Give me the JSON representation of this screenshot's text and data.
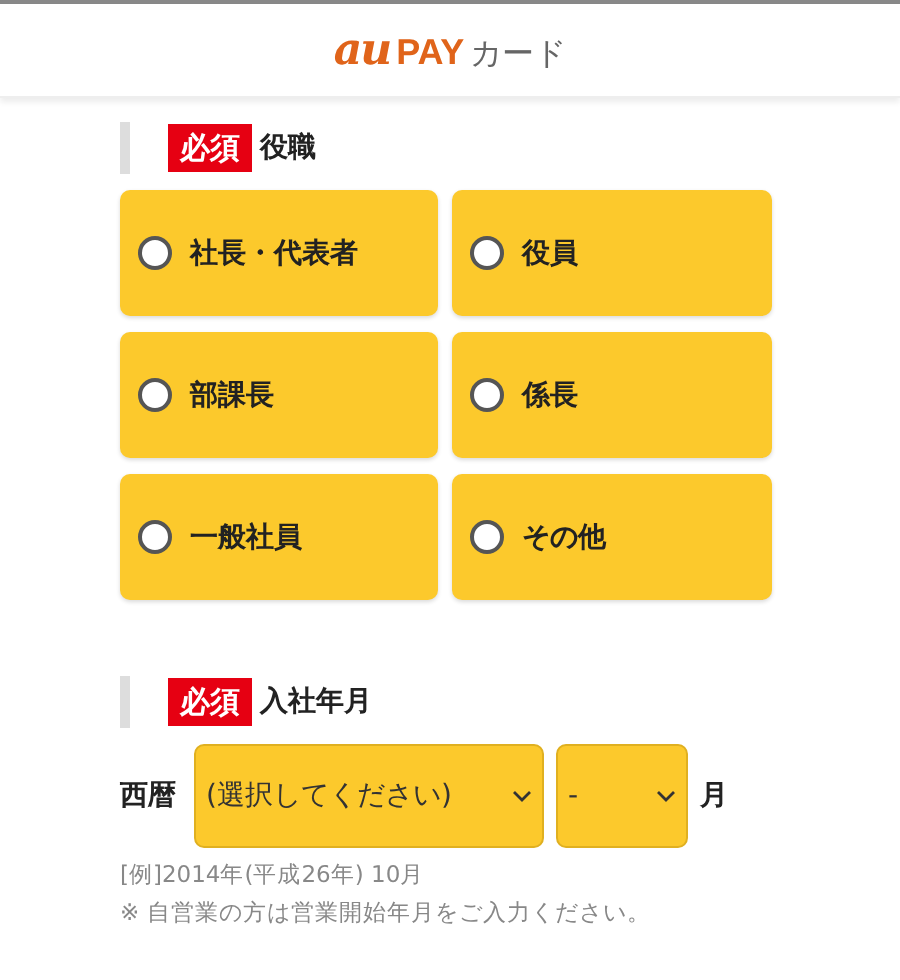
{
  "header": {
    "logo": {
      "brand": "au",
      "pay": "PAY",
      "suffix": "カード"
    }
  },
  "sections": [
    {
      "badge": "必須",
      "label": "役職",
      "kind": "radios",
      "options": [
        {
          "label": "社長・代表者",
          "selected": false
        },
        {
          "label": "役員",
          "selected": false
        },
        {
          "label": "部課長",
          "selected": false
        },
        {
          "label": "係長",
          "selected": false
        },
        {
          "label": "一般社員",
          "selected": false
        },
        {
          "label": "その他",
          "selected": false
        }
      ]
    },
    {
      "badge": "必須",
      "label": "入社年月",
      "kind": "date",
      "prefix": "西暦",
      "year_select": "(選択してください)",
      "month_select": "-",
      "suffix": "月",
      "example": "[例]2014年(平成26年) 10月",
      "note": "※ 自営業の方は営業開始年月をご入力ください。"
    }
  ]
}
